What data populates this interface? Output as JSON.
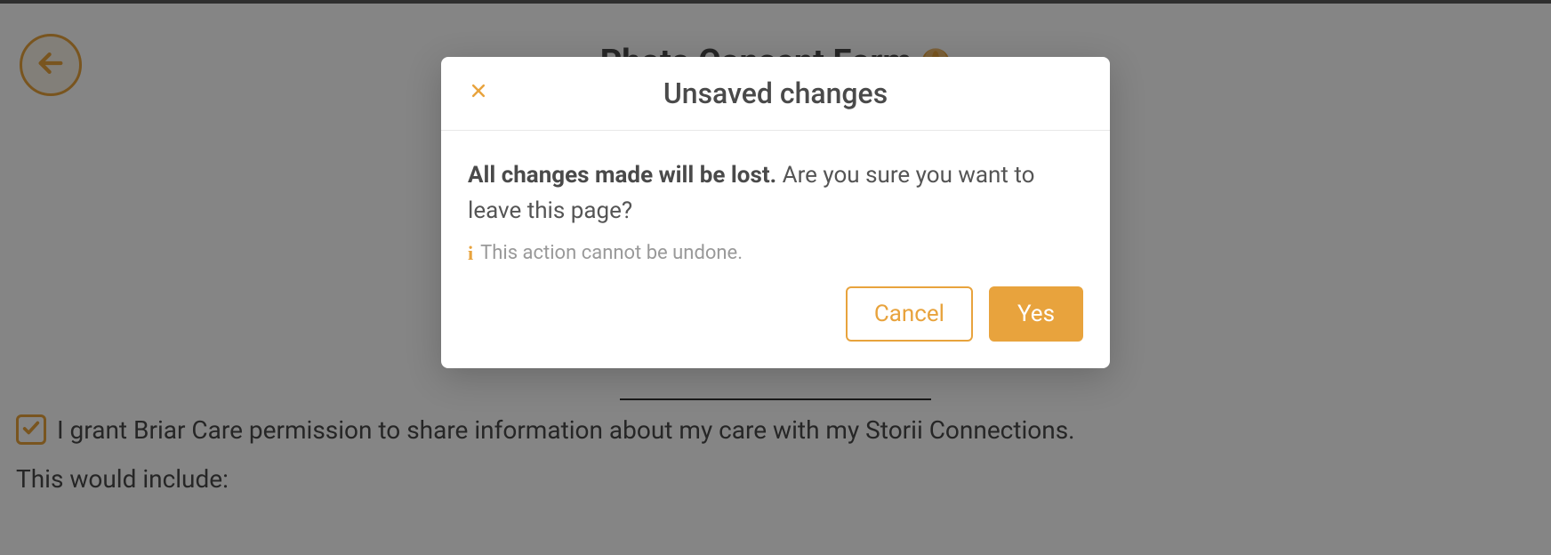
{
  "page": {
    "title": "Photo Consent Form",
    "consent_text": "I grant Briar Care permission to share information about my care with my Storii Connections.",
    "include_text": "This would include:"
  },
  "modal": {
    "title": "Unsaved changes",
    "message_bold": "All changes made will be lost.",
    "message_rest": " Are you sure you want to leave this page?",
    "warning": "This action cannot be undone.",
    "cancel_label": "Cancel",
    "yes_label": "Yes"
  },
  "colors": {
    "accent": "#e8a33d"
  }
}
